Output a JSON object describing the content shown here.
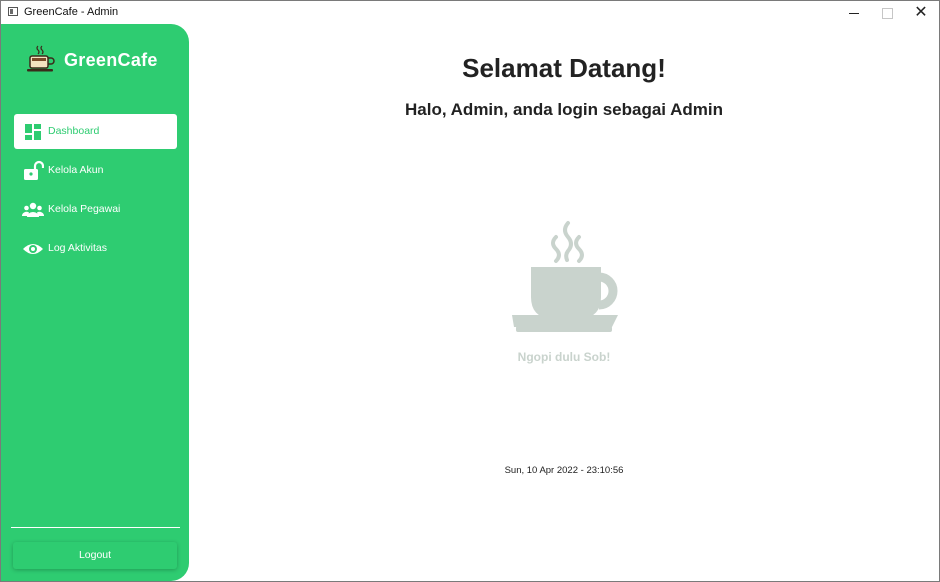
{
  "window": {
    "title": "GreenCafe - Admin",
    "controls": {
      "minimize": "minimize",
      "maximize": "maximize",
      "close": "✕"
    }
  },
  "sidebar": {
    "brand": "GreenCafe",
    "brand_icon": "coffee-cup-icon",
    "items": [
      {
        "label": "Dashboard",
        "icon": "dashboard-icon",
        "active": true
      },
      {
        "label": "Kelola Akun",
        "icon": "unlock-icon",
        "active": false
      },
      {
        "label": "Kelola Pegawai",
        "icon": "users-icon",
        "active": false
      },
      {
        "label": "Log Aktivitas",
        "icon": "eye-icon",
        "active": false
      }
    ],
    "logout_label": "Logout"
  },
  "main": {
    "welcome": "Selamat Datang!",
    "subtitle": "Halo, Admin, anda login sebagai Admin",
    "illustration_icon": "coffee-cup-icon",
    "tagline": "Ngopi dulu Sob!",
    "datetime": "Sun, 10 Apr 2022 - 23:10:56"
  },
  "colors": {
    "accent": "#2ecc71",
    "text": "#222222",
    "illustration": "#c9d3cd"
  }
}
